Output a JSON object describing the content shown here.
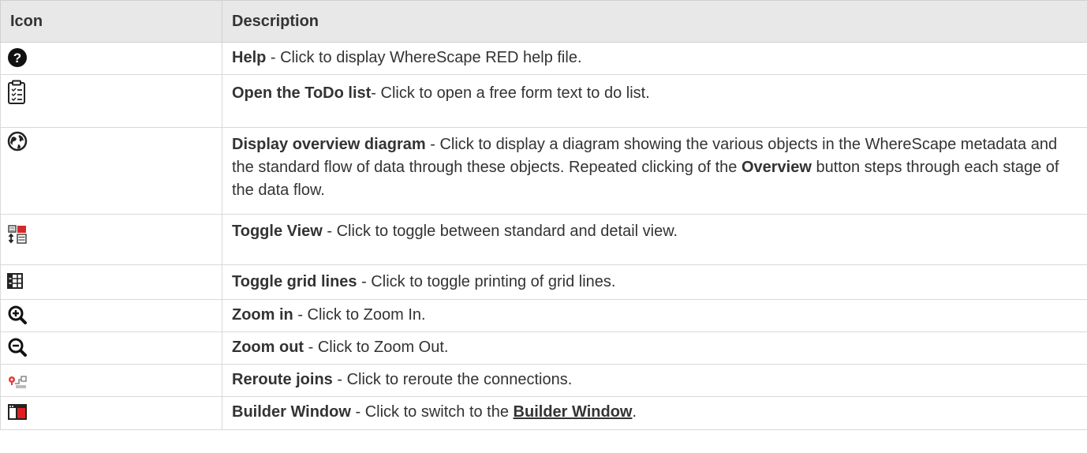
{
  "header": {
    "icon": "Icon",
    "description": "Description"
  },
  "rows": [
    {
      "icon": "help-icon",
      "title": "Help",
      "text": " - Click to display WhereScape RED help file."
    },
    {
      "icon": "todo-list-icon",
      "title": "Open the ToDo list",
      "text": "- Click to open a free form text to do list."
    },
    {
      "icon": "globe-icon",
      "title": "Display overview diagram",
      "text": " - Click to display a diagram showing the various objects in the WhereScape metadata and the standard flow of data through these objects. Repeated clicking of the ",
      "bold2": "Overview",
      "text2": " button steps through each stage of the data flow."
    },
    {
      "icon": "toggle-view-icon",
      "title": "Toggle View",
      "text": " - Click to toggle between standard and detail view."
    },
    {
      "icon": "grid-lines-icon",
      "title": "Toggle grid lines",
      "text": " - Click to toggle printing of grid lines."
    },
    {
      "icon": "zoom-in-icon",
      "title": "Zoom in",
      "text": " - Click to Zoom In."
    },
    {
      "icon": "zoom-out-icon",
      "title": "Zoom out",
      "text": " - Click to Zoom Out."
    },
    {
      "icon": "reroute-joins-icon",
      "title": "Reroute joins",
      "text": " - Click to reroute the connections."
    },
    {
      "icon": "builder-window-icon",
      "title": "Builder Window",
      "text": "  -  Click to switch to the ",
      "link": "Builder Window",
      "text2": "."
    }
  ]
}
